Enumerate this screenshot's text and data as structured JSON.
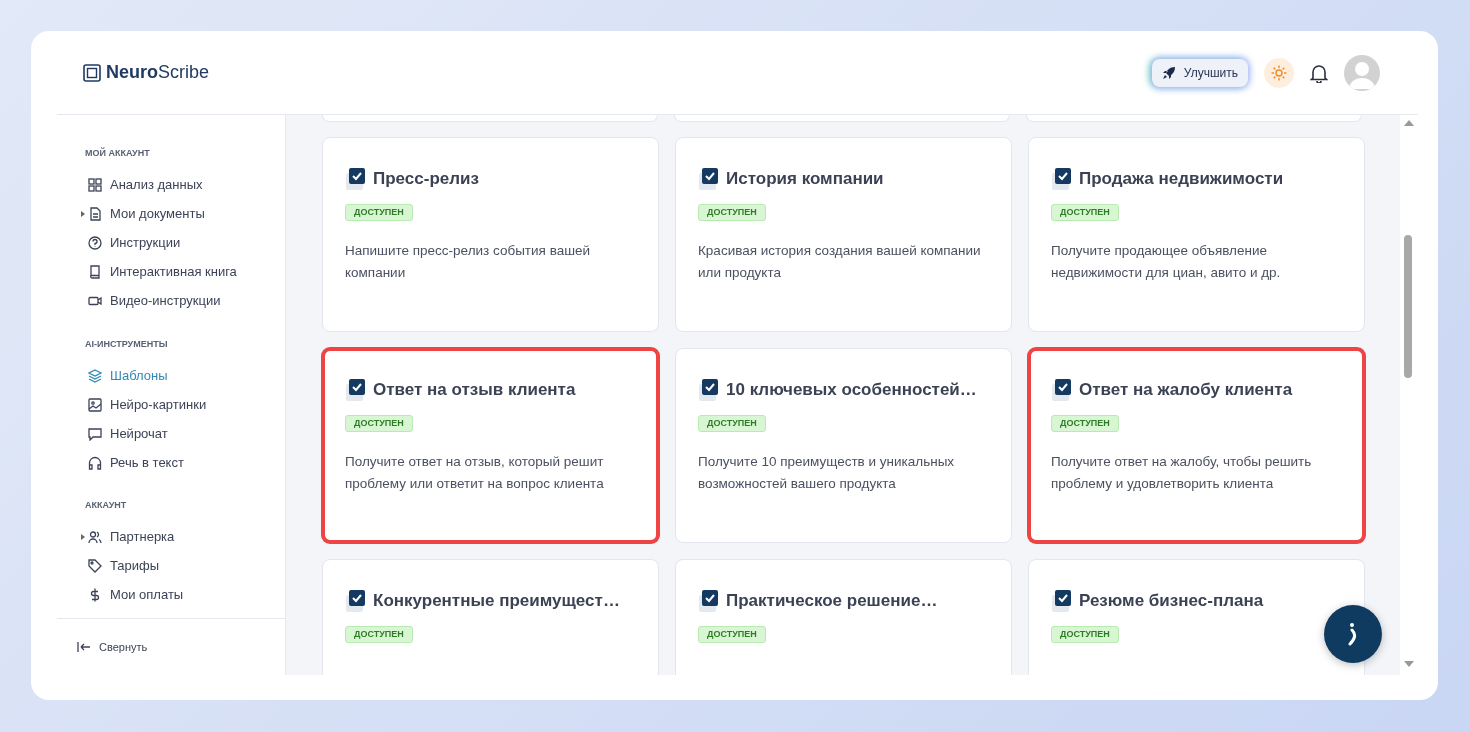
{
  "brand": {
    "bold": "Neuro",
    "light": "Scribe"
  },
  "header": {
    "upgrade_button": "Улучшить"
  },
  "sidebar": {
    "sections": [
      {
        "title": "МОЙ АККАУНТ",
        "items": [
          {
            "label": "Анализ данных",
            "expandable": false,
            "selected": false
          },
          {
            "label": "Мои документы",
            "expandable": true,
            "selected": false
          },
          {
            "label": "Инструкции",
            "expandable": false,
            "selected": false
          },
          {
            "label": "Интерактивная книга",
            "expandable": false,
            "selected": false
          },
          {
            "label": "Видео-инструкции",
            "expandable": false,
            "selected": false
          }
        ]
      },
      {
        "title": "AI-ИНСТРУМЕНТЫ",
        "items": [
          {
            "label": "Шаблоны",
            "expandable": false,
            "selected": true
          },
          {
            "label": "Нейро-картинки",
            "expandable": false,
            "selected": false
          },
          {
            "label": "Нейрочат",
            "expandable": false,
            "selected": false
          },
          {
            "label": "Речь в текст",
            "expandable": false,
            "selected": false
          }
        ]
      },
      {
        "title": "АККАУНТ",
        "items": [
          {
            "label": "Партнерка",
            "expandable": true,
            "selected": false
          },
          {
            "label": "Тарифы",
            "expandable": false,
            "selected": false
          },
          {
            "label": "Мои оплаты",
            "expandable": false,
            "selected": false
          }
        ]
      }
    ],
    "collapse_button": "Свернуть"
  },
  "templates": [
    {
      "title": "Пресс-релиз",
      "status": "ДОСТУПЕН",
      "description": "Напишите пресс-релиз события вашей компании",
      "highlighted": false
    },
    {
      "title": "История компании",
      "status": "ДОСТУПЕН",
      "description": "Красивая история создания вашей компании или продукта",
      "highlighted": false
    },
    {
      "title": "Продажа недвижимости",
      "status": "ДОСТУПЕН",
      "description": "Получите продающее объявление недвижимости для циан, авито и др.",
      "highlighted": false
    },
    {
      "title": "Ответ на отзыв клиента",
      "status": "ДОСТУПЕН",
      "description": "Получите ответ на отзыв, который решит проблему или ответит на вопрос клиента",
      "highlighted": true
    },
    {
      "title": "10 ключевых особенностей…",
      "status": "ДОСТУПЕН",
      "description": "Получите 10 преимуществ и уникальных возможностей вашего продукта",
      "highlighted": false
    },
    {
      "title": "Ответ на жалобу клиента",
      "status": "ДОСТУПЕН",
      "description": "Получите ответ на жалобу, чтобы решить проблему и удовлетворить клиента",
      "highlighted": true
    },
    {
      "title": "Конкурентные преимущест…",
      "status": "ДОСТУПЕН",
      "highlighted": false
    },
    {
      "title": "Практическое решение…",
      "status": "ДОСТУПЕН",
      "highlighted": false
    },
    {
      "title": "Резюме бизнес-плана",
      "status": "ДОСТУПЕН",
      "highlighted": false
    }
  ]
}
